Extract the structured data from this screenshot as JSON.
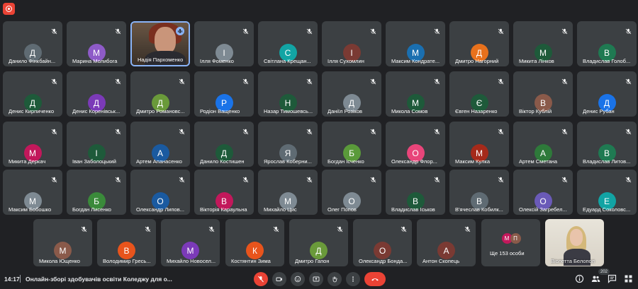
{
  "meeting": {
    "clock": "14:17",
    "title": "Онлайн-зборі здобувачів освіти Коледжу для о...",
    "participant_count": "202"
  },
  "rows": [
    [
      {
        "name": "Данило Фінкбайн...",
        "initial": "Д",
        "color": "#5f6b73"
      },
      {
        "name": "Марина Молибога",
        "initial": "М",
        "color": "#8e5bc8"
      },
      {
        "name": "Надія Пархоменко",
        "initial": "",
        "color": "",
        "speaking": true
      },
      {
        "name": "Ілля Фоменко",
        "initial": "І",
        "color": "#7e8a93"
      },
      {
        "name": "Світлана Крещан...",
        "initial": "С",
        "color": "#12a4a4"
      },
      {
        "name": "Ілля Сухомлин",
        "initial": "І",
        "color": "#7a3a33"
      },
      {
        "name": "Максим Кондрате...",
        "initial": "М",
        "color": "#1a6fb0"
      },
      {
        "name": "Дмитро Нагорний",
        "initial": "Д",
        "color": "#e8711c"
      },
      {
        "name": "Микита Лінков",
        "initial": "М",
        "color": "#1e5a3a"
      },
      {
        "name": "Владислав Голоб...",
        "initial": "В",
        "color": "#1f7a52"
      }
    ],
    [
      {
        "name": "Денис Кирпиченко",
        "initial": "Д",
        "color": "#1e5a3a"
      },
      {
        "name": "Денис Коренівськ...",
        "initial": "Д",
        "color": "#7b3ab8"
      },
      {
        "name": "Дмитро Романовс...",
        "initial": "Д",
        "color": "#6a9a3a"
      },
      {
        "name": "Родіон Ващенко",
        "initial": "Р",
        "color": "#1a73e8"
      },
      {
        "name": "Назар Тимошевсь...",
        "initial": "Н",
        "color": "#1e5a3a"
      },
      {
        "name": "Даніїл Розіков",
        "initial": "Д",
        "color": "#7e8a93"
      },
      {
        "name": "Микола Сомов",
        "initial": "М",
        "color": "#1e5a3a"
      },
      {
        "name": "Євген Назаренко",
        "initial": "Є",
        "color": "#1e5a3a"
      },
      {
        "name": "Віктор Кублій",
        "initial": "В",
        "color": "#8a5a4a"
      },
      {
        "name": "Денис Рубан",
        "initial": "Д",
        "color": "#1a73e8"
      }
    ],
    [
      {
        "name": "Микита Деркач",
        "initial": "М",
        "color": "#c2185b"
      },
      {
        "name": "Іван Заболоцький",
        "initial": "І",
        "color": "#1e5a3a"
      },
      {
        "name": "Артем Апанасенко",
        "initial": "А",
        "color": "#1a5aa0"
      },
      {
        "name": "Данило Костишен",
        "initial": "Д",
        "color": "#1e5a3a"
      },
      {
        "name": "Ярослав Коберни...",
        "initial": "Я",
        "color": "#5f6b73"
      },
      {
        "name": "Богдан Ісченко",
        "initial": "Б",
        "color": "#5a9a3a"
      },
      {
        "name": "Олександр Флор...",
        "initial": "О",
        "color": "#e8457a"
      },
      {
        "name": "Максим Кулка",
        "initial": "М",
        "color": "#a52a1a"
      },
      {
        "name": "Артем Сметана",
        "initial": "А",
        "color": "#2e7a3a"
      },
      {
        "name": "Владислав Литов...",
        "initial": "В",
        "color": "#1f7a52"
      }
    ],
    [
      {
        "name": "Максим Бобошко",
        "initial": "М",
        "color": "#7e8a93"
      },
      {
        "name": "Богдан Лисенко",
        "initial": "Б",
        "color": "#3a8a3a"
      },
      {
        "name": "Олександр Липов...",
        "initial": "О",
        "color": "#1a5aa0"
      },
      {
        "name": "Вікторія Караульна",
        "initial": "В",
        "color": "#c2185b"
      },
      {
        "name": "Михайло Цис",
        "initial": "М",
        "color": "#7e8a93"
      },
      {
        "name": "Олег Попов",
        "initial": "О",
        "color": "#7e8a93"
      },
      {
        "name": "Владислав Іськов",
        "initial": "В",
        "color": "#1e5a3a"
      },
      {
        "name": "В'ячеслав Кобилк...",
        "initial": "В",
        "color": "#5f6b73"
      },
      {
        "name": "Олексій Загребел...",
        "initial": "О",
        "color": "#6a5ab8"
      },
      {
        "name": "Едуард Соколовс...",
        "initial": "Е",
        "color": "#12a4a4"
      }
    ],
    [
      {
        "name": "Микола Ющенко",
        "initial": "М",
        "color": "#8a5a4a"
      },
      {
        "name": "Володимир Гресь...",
        "initial": "В",
        "color": "#e8541c"
      },
      {
        "name": "Михайло Новосел...",
        "initial": "М",
        "color": "#7b3ab8"
      },
      {
        "name": "Костянтин Зима",
        "initial": "К",
        "color": "#e8541c"
      },
      {
        "name": "Дмитро Гапон",
        "initial": "Д",
        "color": "#6a9a3a"
      },
      {
        "name": "Олександр Бонда...",
        "initial": "О",
        "color": "#7a3a33"
      },
      {
        "name": "Антон Скопець",
        "initial": "А",
        "color": "#7a3a33"
      },
      {
        "name": "Ще 153 особи",
        "others": true,
        "mini": [
          {
            "initial": "М",
            "color": "#c2185b"
          },
          {
            "initial": "П",
            "color": "#8a5a4a"
          }
        ]
      },
      {
        "name": "Віолетта Белопол",
        "initial": "",
        "color": "",
        "photo": true
      }
    ]
  ]
}
